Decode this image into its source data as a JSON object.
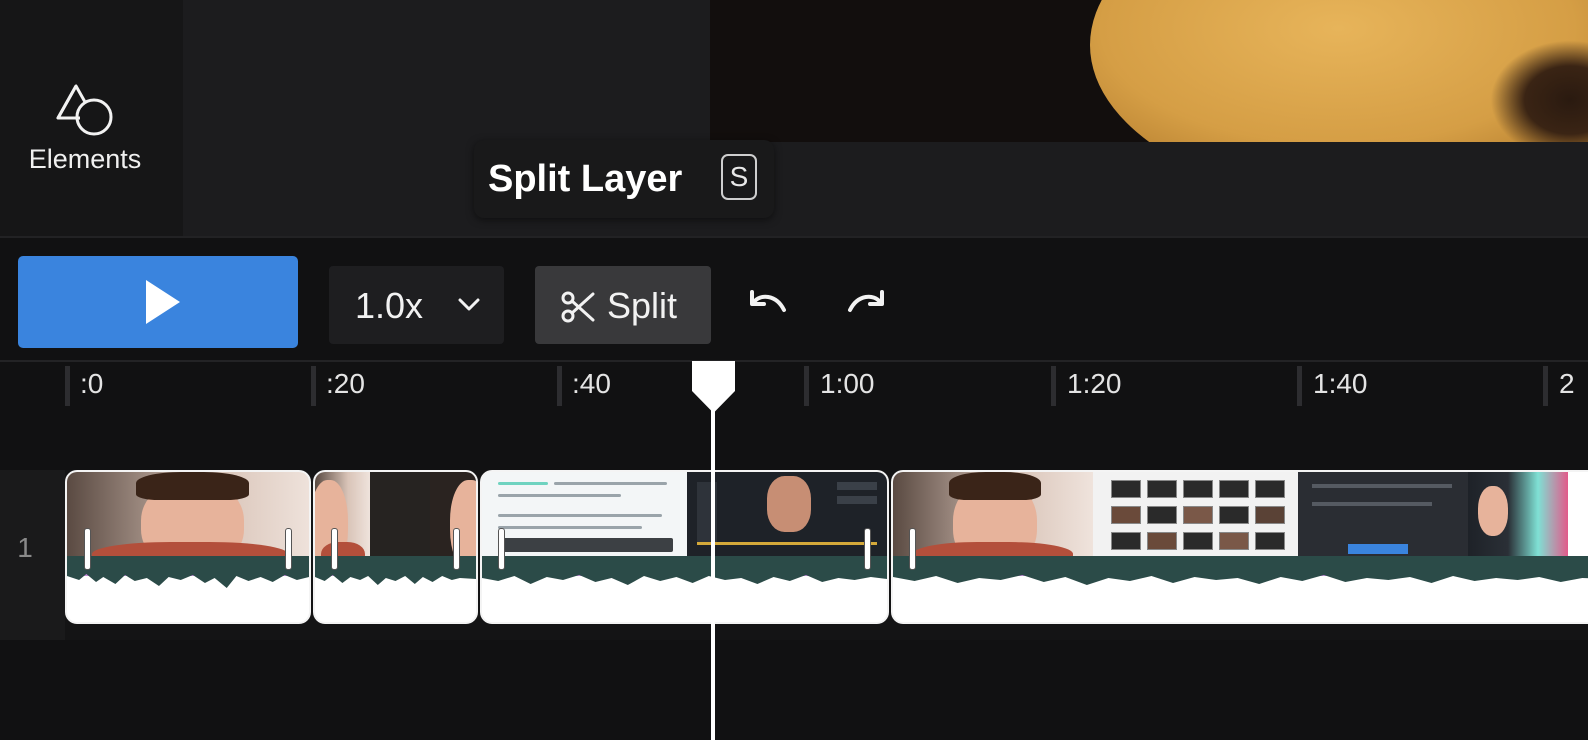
{
  "sidebar": {
    "elements_label": "Elements"
  },
  "tooltip": {
    "label": "Split Layer",
    "shortcut": "S"
  },
  "toolbar": {
    "play_label": "",
    "speed_value": "1.0x",
    "split_label": "Split"
  },
  "timeline": {
    "ruler_labels": [
      ":0",
      ":20",
      ":40",
      "1:00",
      "1:20",
      "1:40",
      "2"
    ],
    "playhead_time": ":48",
    "tracks": [
      {
        "number": "1"
      }
    ]
  },
  "colors": {
    "accent": "#3a84de",
    "clip_border": "#f4f4f4",
    "waveform_bar": "#2b4b48",
    "audio_line": "#c58bd8",
    "background": "#111112"
  },
  "icons": [
    "elements-icon",
    "play-icon",
    "chevron-down-icon",
    "scissors-icon",
    "undo-icon",
    "redo-icon",
    "playhead-icon"
  ]
}
